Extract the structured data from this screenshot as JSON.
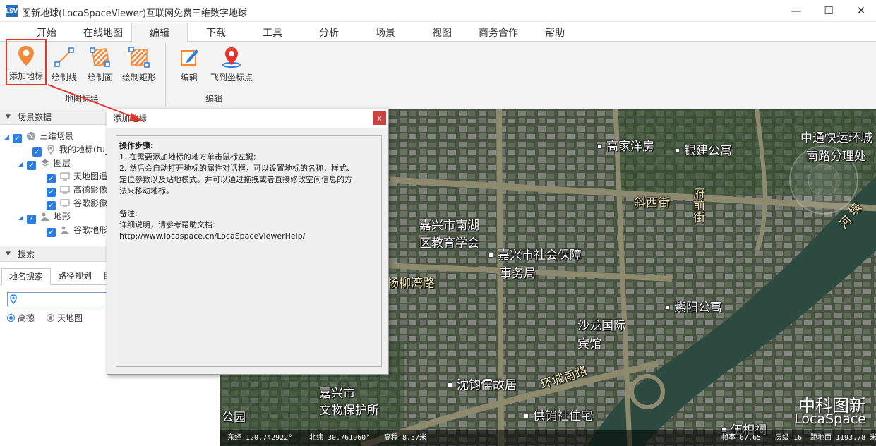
{
  "window": {
    "title": "图新地球(LocaSpaceViewer)互联网免费三维数字地球",
    "app_icon_text": "LSV",
    "minimize": "—",
    "maximize": "☐",
    "close": "✕"
  },
  "tabs": [
    "开始",
    "在线地图",
    "编辑",
    "下载",
    "工具",
    "分析",
    "场景",
    "视图",
    "商务合作",
    "帮助"
  ],
  "active_tab": "编辑",
  "ribbon": {
    "group1": {
      "label": "地图标绘",
      "buttons": [
        "添加地标",
        "绘制线",
        "绘制面",
        "绘制矩形"
      ]
    },
    "group2": {
      "label": "编辑",
      "buttons": [
        "编辑",
        "飞到坐标点"
      ]
    },
    "colors": {
      "orange": "#f08a3b",
      "red": "#e5332a",
      "blue": "#2a7de1"
    }
  },
  "scene_panel": {
    "header": "场景数据",
    "tree": [
      {
        "label": "三维场景",
        "icon": "globe-icon"
      },
      {
        "label": "我的地标(tu_",
        "icon": "pin-icon"
      },
      {
        "label": "图层",
        "icon": "layers-icon"
      },
      {
        "label": "天地图遥",
        "icon": "monitor-icon"
      },
      {
        "label": "高德影像",
        "icon": "monitor-icon"
      },
      {
        "label": "谷歌影像",
        "icon": "monitor-icon"
      },
      {
        "label": "地形",
        "icon": "terrain-icon"
      },
      {
        "label": "谷歌地形",
        "icon": "terrain-icon"
      }
    ]
  },
  "search_panel": {
    "header": "搜索",
    "tabs": [
      "地名搜索",
      "路径规划",
      "目"
    ],
    "input_value": "",
    "sources": [
      {
        "label": "高德",
        "selected": true
      },
      {
        "label": "天地图",
        "selected": false
      }
    ]
  },
  "dialog": {
    "title": "添加地标",
    "close": "x",
    "steps_title": "操作步骤:",
    "step1": "1. 在需要添加地标的地方单击鼠标左键;",
    "step2a": "2. 然后会自动打开地标的属性对话框，可以设置地标的名称，样式、",
    "step2b": "定位参数以及贴地模式。并可以通过拖拽或者直接修改空间信息的方",
    "step2c": "法来移动地标。",
    "note_title": "备注:",
    "note_text": "详细说明，请参考帮助文档:",
    "help_url": "http://www.locaspace.cn/LocaSpaceViewerHelp/"
  },
  "map": {
    "labels": {
      "gaojia": "高家洋房",
      "yinjian": "银建公寓",
      "zhongtong1": "中通快运环城",
      "zhongtong2": "南路分理处",
      "xiexijie": "斜西街",
      "fuqianjie": "府前街",
      "nanhu1": "嘉兴市南湖",
      "nanhu2": "区教育学会",
      "shebao1": "嘉兴市社会保障",
      "shebao2": "事务局",
      "yangliu": "杨柳湾路",
      "ziyang": "紫阳公寓",
      "shalong1": "沙龙国际",
      "shalong2": "宾馆",
      "huancheng": "环城南路",
      "shenjun": "沈钧儒故居",
      "wenwu1": "嘉兴市",
      "wenwu2": "文物保护所",
      "gongxiao": "供销社住宅",
      "gong": "公园",
      "wu": "伍相祠",
      "right_road": "壕",
      "right_road2": "河"
    },
    "brand_cn": "中科图新",
    "brand_en": "LocaSpace",
    "status": {
      "lon": "东经 120.742922°",
      "lat": "北纬 30.761960°",
      "alt": "高程 8.57米",
      "fps": "帧率 67.65",
      "level": "层级 16",
      "dist": "距地面 1193.78 米"
    }
  }
}
